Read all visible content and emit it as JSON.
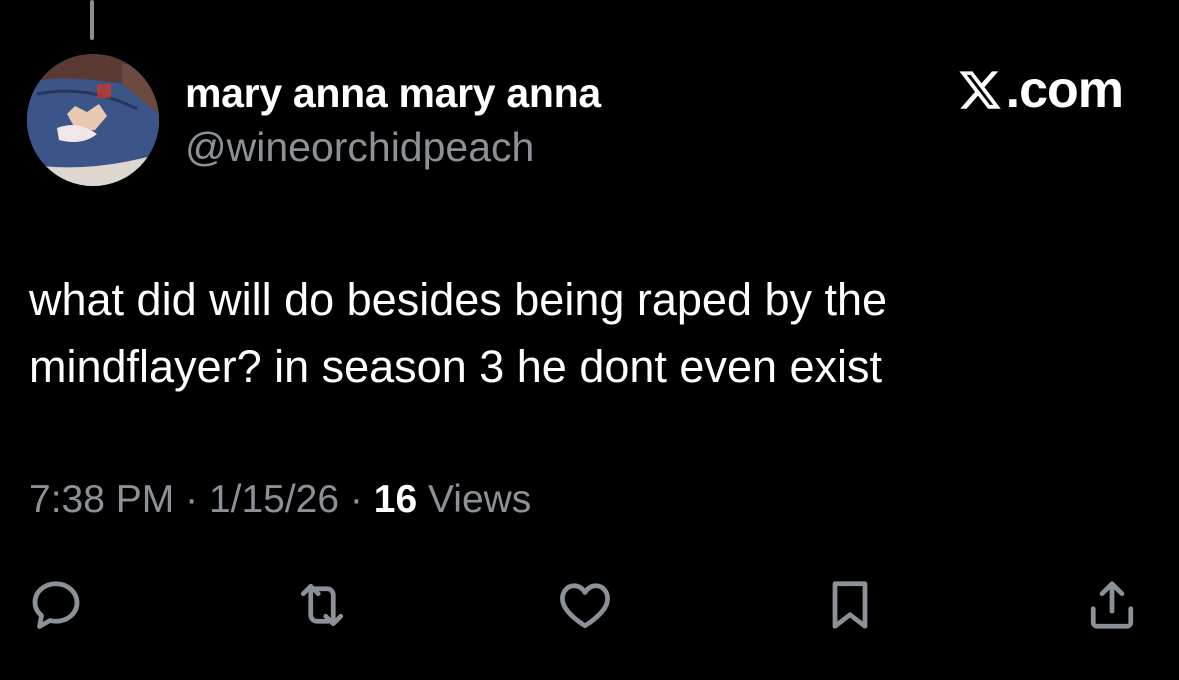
{
  "tweet": {
    "author": {
      "display_name": "mary anna mary anna",
      "handle": "@wineorchidpeach"
    },
    "brand": {
      "text": ".com",
      "icon": "x-logo-icon"
    },
    "text_line_1": "what did will do besides being raped by the",
    "text_line_2": "mindflayer? in season 3 he dont even exist",
    "time": "7:38 PM",
    "separator": "·",
    "date": "1/15/26",
    "views_count": "16",
    "views_label": "Views"
  },
  "actions": [
    {
      "name": "reply",
      "icon": "speech-bubble-icon"
    },
    {
      "name": "repost",
      "icon": "repost-icon"
    },
    {
      "name": "like",
      "icon": "heart-icon"
    },
    {
      "name": "bookmark",
      "icon": "bookmark-icon"
    },
    {
      "name": "share",
      "icon": "share-icon"
    }
  ],
  "colors": {
    "background": "#000000",
    "text_primary": "#ffffff",
    "text_secondary": "#8b9197"
  }
}
